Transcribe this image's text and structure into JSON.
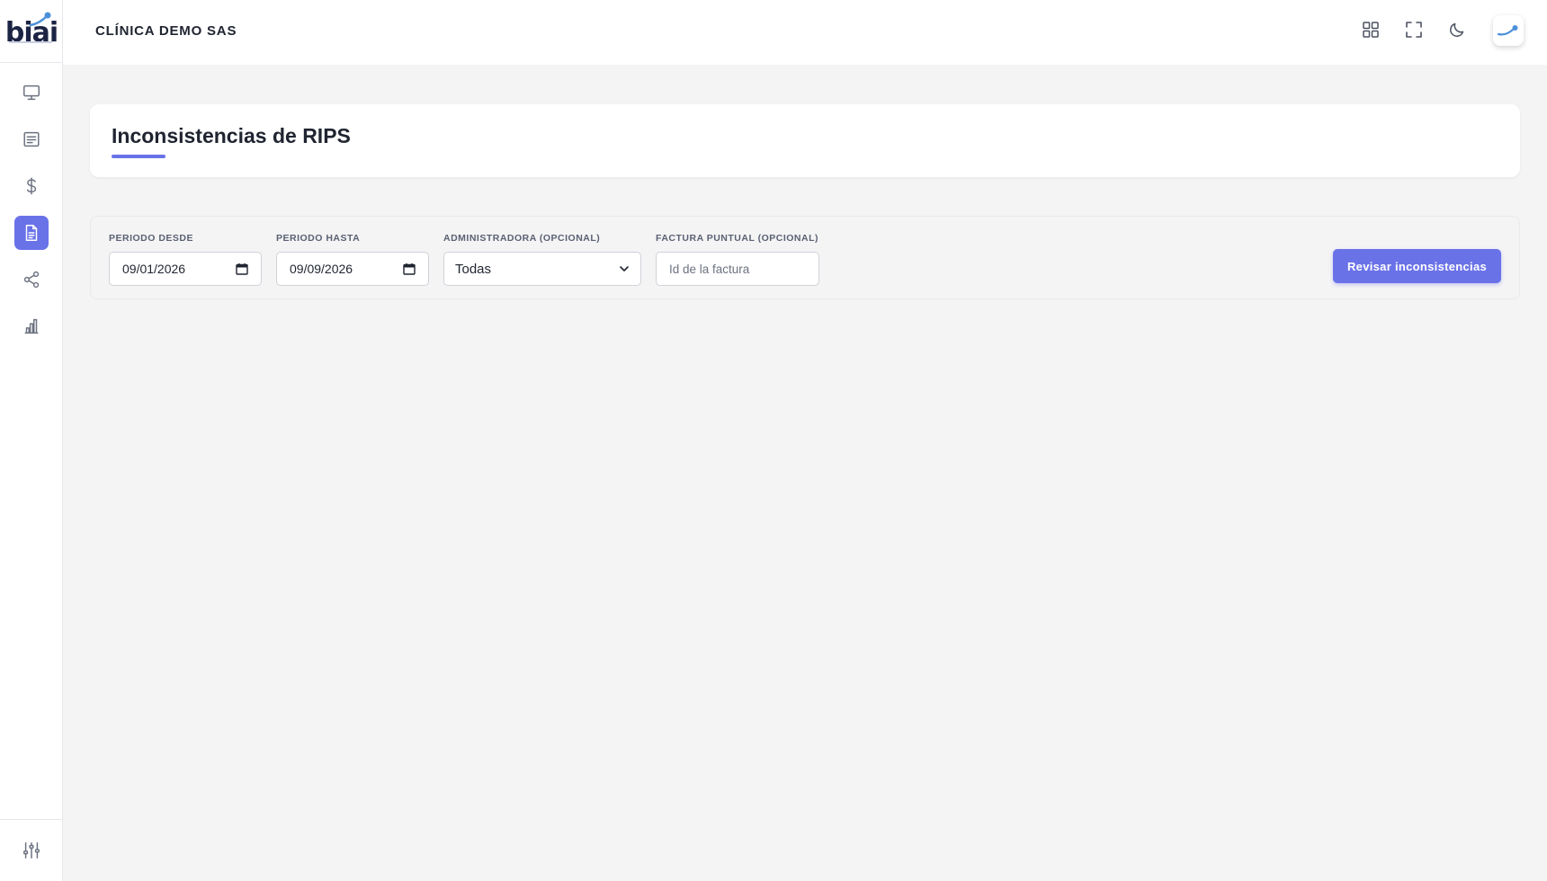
{
  "app": {
    "logo_text": "biai",
    "company_name": "CLÍNICA DEMO SAS"
  },
  "sidebar": {
    "items": [
      {
        "icon": "monitor-icon",
        "active": false
      },
      {
        "icon": "document-list-icon",
        "active": false
      },
      {
        "icon": "dollar-icon",
        "active": false
      },
      {
        "icon": "file-text-icon",
        "active": true
      },
      {
        "icon": "share-icon",
        "active": false
      },
      {
        "icon": "bar-chart-icon",
        "active": false
      }
    ],
    "bottom_icon": "sliders-icon"
  },
  "header_icons": [
    "grid-icon",
    "fullscreen-icon",
    "moon-icon",
    "user-avatar"
  ],
  "page": {
    "title": "Inconsistencias de RIPS"
  },
  "filters": {
    "periodo_desde": {
      "label": "PERIODO DESDE",
      "value": "09/01/2026"
    },
    "periodo_hasta": {
      "label": "PERIODO HASTA",
      "value": "09/09/2026"
    },
    "administradora": {
      "label": "ADMINISTRADORA (OPCIONAL)",
      "value": "Todas"
    },
    "factura": {
      "label": "FACTURA PUNTUAL (OPCIONAL)",
      "placeholder": "Id de la factura"
    },
    "submit_label": "Revisar inconsistencias"
  },
  "colors": {
    "accent": "#6a72e8",
    "background": "#f4f4f5",
    "text": "#1f2430"
  }
}
